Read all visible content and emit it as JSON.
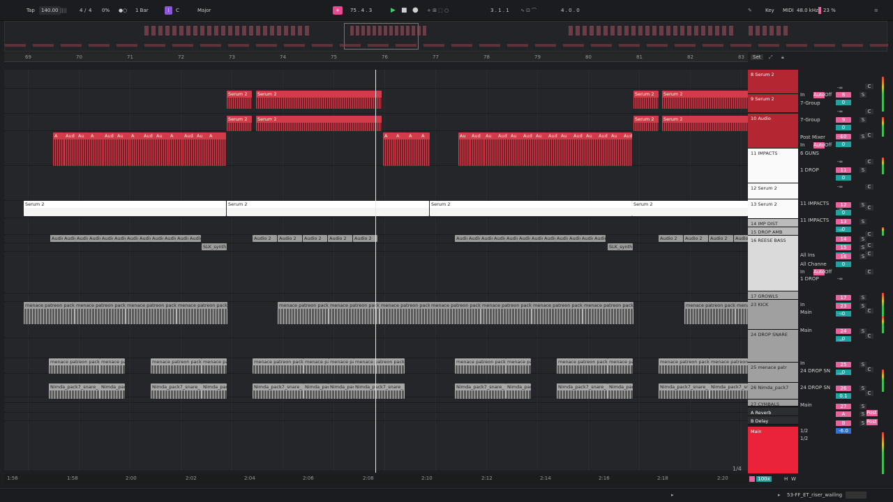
{
  "transport": {
    "tap": "Tap",
    "tempo": "140.00",
    "time_sig_num": "4",
    "time_sig_den": "4",
    "swing": "0%",
    "quantize": "1 Bar",
    "key": "C",
    "scale": "Major",
    "position": "75 . 4 . 3",
    "loop_start": "3 . 1 . 1",
    "loop_length": "4 . 0 . 0",
    "key_btn": "Key",
    "midi_btn": "MIDI",
    "sample_rate": "48.0 kHz",
    "cpu": "23 %"
  },
  "ruler": {
    "bars": [
      "69",
      "70",
      "71",
      "72",
      "73",
      "74",
      "75",
      "76",
      "77",
      "78",
      "79",
      "80",
      "81",
      "82",
      "83"
    ]
  },
  "timeline": {
    "times": [
      "1:56",
      "1:58",
      "2:00",
      "2:02",
      "2:04",
      "2:06",
      "2:08",
      "2:10",
      "2:12",
      "2:14",
      "2:16",
      "2:18",
      "2:20"
    ],
    "page": "1/4"
  },
  "clips": {
    "serum": "Serum 2",
    "audio": "Audio 2",
    "aud": "Aud",
    "audio1": "Audio",
    "a": "A",
    "au": "Au",
    "slk": "SLK_synth",
    "menace": "menace patreon pack",
    "menace_short": "menace patreon pack",
    "nimda": "Nimda_pack7_snare_",
    "nimda_short": "Nimda_pack"
  },
  "tracks": [
    {
      "name": "8 Serum 2"
    },
    {
      "name": "9 Serum 2"
    },
    {
      "name": "10 Audio"
    },
    {
      "name": "11 IMPACTS"
    },
    {
      "name": "12 Serum 2"
    },
    {
      "name": "13 Serum 2"
    },
    {
      "name": "14 IMP DIST"
    },
    {
      "name": "15 DROP AMB"
    },
    {
      "name": "16 REESE BASS"
    },
    {
      "name": "17 GROWLS"
    },
    {
      "name": "23 KICK"
    },
    {
      "name": "24 DROP SNARE"
    },
    {
      "name": "25 menace patr"
    },
    {
      "name": "26 Nimda_pack7"
    },
    {
      "name": "27 CYMBALS"
    },
    {
      "name": "A Reverb"
    },
    {
      "name": "B Delay"
    },
    {
      "name": "Main"
    }
  ],
  "mixer": {
    "in": "In",
    "auto": "Auto",
    "off": "Off",
    "group7": "7-Group",
    "post_mixer": "Post Mixer",
    "guns": "6 GUNS",
    "drop1": "1 DROP",
    "impacts11": "11 IMPACTS",
    "all_ins": "All Ins",
    "all_channels": "All Channe",
    "main": "Main",
    "snare24": "24 DROP SN",
    "post": "Post",
    "half": "1/2",
    "nums": [
      "8",
      "9",
      "10",
      "11",
      "12",
      "13",
      "14",
      "15",
      "16",
      "17",
      "23",
      "24",
      "25",
      "26",
      "27",
      "A",
      "B"
    ],
    "vol0": "0",
    "vol01": "0.1",
    "volmain": "-6.0",
    "inf": "-∞",
    "s": "S",
    "c": "C"
  },
  "status": {
    "file": "53-FF_ET_riser_wailing",
    "zoom": "100x",
    "h": "H",
    "w": "W",
    "set": "Set"
  }
}
